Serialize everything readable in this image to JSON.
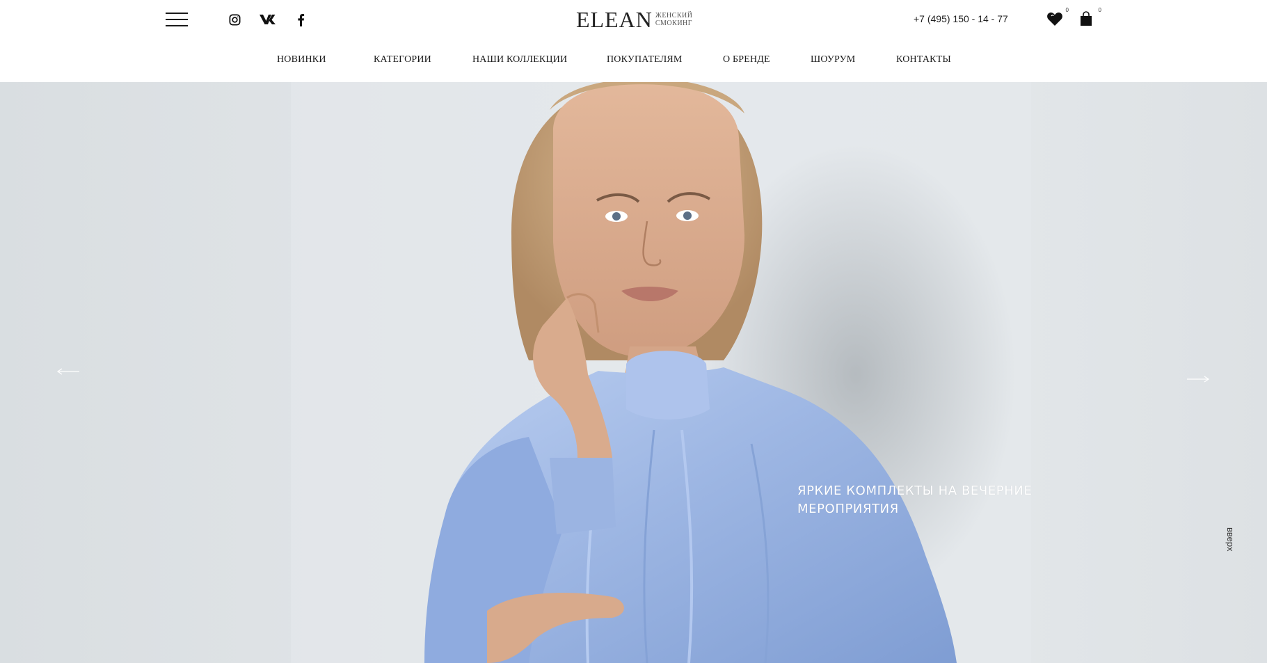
{
  "header": {
    "logo": {
      "word": "ELEAN",
      "sub_line1": "ЖЕНСКИЙ",
      "sub_line2": "СМОКИНГ"
    },
    "phone": "+7 (495) 150 - 14 - 77",
    "wishlist_count": "0",
    "cart_count": "0",
    "social": [
      "instagram-icon",
      "vk-icon",
      "facebook-icon"
    ]
  },
  "nav": {
    "items": [
      {
        "label": "НОВИНКИ"
      },
      {
        "label": "КАТЕГОРИИ"
      },
      {
        "label": "НАШИ КОЛЛЕКЦИИ"
      },
      {
        "label": "ПОКУПАТЕЛЯМ"
      },
      {
        "label": "О БРЕНДЕ"
      },
      {
        "label": "ШОУРУМ"
      },
      {
        "label": "КОНТАКТЫ"
      }
    ]
  },
  "hero": {
    "caption_line1": "ЯРКИЕ КОМПЛЕКТЫ НА ВЕЧЕРНИЕ",
    "caption_line2": "МЕРОПРИЯТИЯ",
    "blouse_color": "#9fb8e4",
    "background_color": "#e0e4e7"
  },
  "to_top": "вверх",
  "colors": {
    "text": "#1a1a1a",
    "white": "#ffffff"
  }
}
